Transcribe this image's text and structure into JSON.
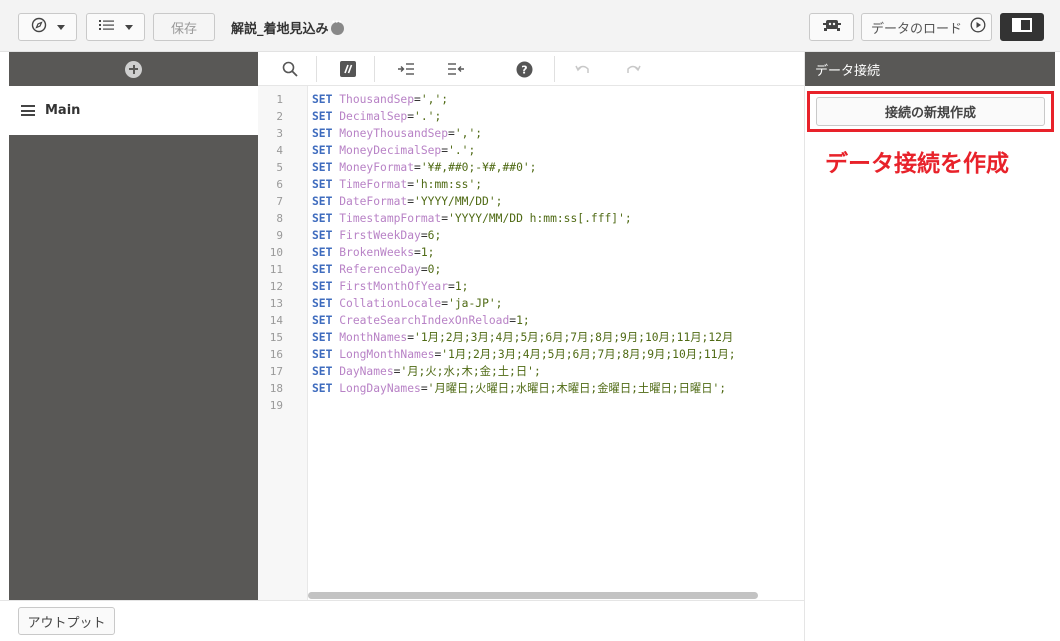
{
  "toolbar": {
    "save_label": "保存",
    "app_title": "解説_着地見込み",
    "load_data_label": "データのロード"
  },
  "left_panel": {
    "sections": [
      {
        "label": "Main"
      }
    ]
  },
  "editor": {
    "line_numbers": [
      "1",
      "2",
      "3",
      "4",
      "5",
      "6",
      "7",
      "8",
      "9",
      "10",
      "11",
      "12",
      "13",
      "14",
      "15",
      "16",
      "17",
      "18",
      "19"
    ],
    "lines": [
      {
        "kw": "SET",
        "var": "ThousandSep",
        "op": "=",
        "val": "',';"
      },
      {
        "kw": "SET",
        "var": "DecimalSep",
        "op": "=",
        "val": "'.';"
      },
      {
        "kw": "SET",
        "var": "MoneyThousandSep",
        "op": "=",
        "val": "',';"
      },
      {
        "kw": "SET",
        "var": "MoneyDecimalSep",
        "op": "=",
        "val": "'.';"
      },
      {
        "kw": "SET",
        "var": "MoneyFormat",
        "op": "=",
        "val": "'¥#,##0;-¥#,##0';"
      },
      {
        "kw": "SET",
        "var": "TimeFormat",
        "op": "=",
        "val": "'h:mm:ss';"
      },
      {
        "kw": "SET",
        "var": "DateFormat",
        "op": "=",
        "val": "'YYYY/MM/DD';"
      },
      {
        "kw": "SET",
        "var": "TimestampFormat",
        "op": "=",
        "val": "'YYYY/MM/DD h:mm:ss[.fff]';"
      },
      {
        "kw": "SET",
        "var": "FirstWeekDay",
        "op": "=",
        "val": "6;"
      },
      {
        "kw": "SET",
        "var": "BrokenWeeks",
        "op": "=",
        "val": "1;"
      },
      {
        "kw": "SET",
        "var": "ReferenceDay",
        "op": "=",
        "val": "0;"
      },
      {
        "kw": "SET",
        "var": "FirstMonthOfYear",
        "op": "=",
        "val": "1;"
      },
      {
        "kw": "SET",
        "var": "CollationLocale",
        "op": "=",
        "val": "'ja-JP';"
      },
      {
        "kw": "SET",
        "var": "CreateSearchIndexOnReload",
        "op": "=",
        "val": "1;"
      },
      {
        "kw": "SET",
        "var": "MonthNames",
        "op": "=",
        "val": "'1月;2月;3月;4月;5月;6月;7月;8月;9月;10月;11月;12月"
      },
      {
        "kw": "SET",
        "var": "LongMonthNames",
        "op": "=",
        "val": "'1月;2月;3月;4月;5月;6月;7月;8月;9月;10月;11月;"
      },
      {
        "kw": "SET",
        "var": "DayNames",
        "op": "=",
        "val": "'月;火;水;木;金;土;日';"
      },
      {
        "kw": "SET",
        "var": "LongDayNames",
        "op": "=",
        "val": "'月曜日;火曜日;水曜日;木曜日;金曜日;土曜日;日曜日';"
      }
    ]
  },
  "right_panel": {
    "header": "データ接続",
    "create_connection_label": "接続の新規作成",
    "annotation": "データ接続を作成"
  },
  "bottom": {
    "output_label": "アウトプット"
  },
  "colors": {
    "panel_dark": "#595856",
    "keyword": "#3f6cbe",
    "variable": "#b882c6",
    "string": "#4f6a14",
    "highlight_red": "#e8222a"
  },
  "icons": [
    "compass-icon",
    "list-icon",
    "dots-icon",
    "debug-icon",
    "play-icon",
    "panel-toggle-icon",
    "plus-icon",
    "menu-icon",
    "search-icon",
    "comment-icon",
    "indent-icon",
    "outdent-icon",
    "help-icon",
    "undo-icon",
    "redo-icon"
  ]
}
